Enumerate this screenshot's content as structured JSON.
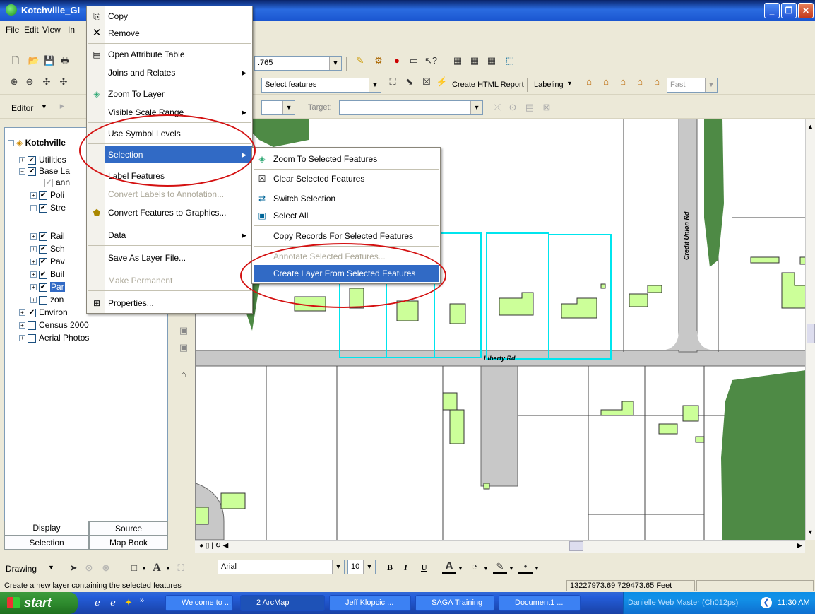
{
  "window": {
    "title": "Kotchville_GI"
  },
  "menubar": {
    "items": [
      "File",
      "Edit",
      "View",
      "In"
    ]
  },
  "toolbar1": {
    "scale_value": ".765"
  },
  "toolbar2": {
    "selection_combo": "Select features",
    "create_report": "Create HTML Report",
    "labeling": "Labeling",
    "fast_combo": "Fast"
  },
  "editor": {
    "label": "Editor",
    "target_label": "Target:"
  },
  "toc": {
    "root": "Kotchville",
    "layers": [
      {
        "label": "Utilities",
        "checked": true
      },
      {
        "label": "Base La",
        "checked": true
      },
      {
        "label": "ann",
        "checked": true
      },
      {
        "label": "Poli",
        "checked": true
      },
      {
        "label": "Stre",
        "checked": true
      },
      {
        "label": "Rail",
        "checked": true
      },
      {
        "label": "Sch",
        "checked": true
      },
      {
        "label": "Pav",
        "checked": true
      },
      {
        "label": "Buil",
        "checked": true
      },
      {
        "label": "Par",
        "checked": true
      },
      {
        "label": "zon",
        "checked": false
      },
      {
        "label": "Environ",
        "checked": true
      },
      {
        "label": "Census 2000",
        "checked": false
      },
      {
        "label": "Aerial Photos",
        "checked": false
      }
    ]
  },
  "toc_tabs": {
    "display": "Display",
    "source": "Source",
    "selection": "Selection",
    "mapbook": "Map Book"
  },
  "context_menu": {
    "items": [
      {
        "label": "Copy",
        "icon": "copy-icon"
      },
      {
        "label": "Remove",
        "icon": "remove-icon"
      },
      {
        "label": "Open Attribute Table",
        "icon": "table-icon"
      },
      {
        "label": "Joins and Relates",
        "submenu": true
      },
      {
        "label": "Zoom To Layer",
        "icon": "zoom-layer-icon"
      },
      {
        "label": "Visible Scale Range",
        "submenu": true
      },
      {
        "label": "Use Symbol Levels"
      },
      {
        "label": "Selection",
        "submenu": true,
        "highlighted": true
      },
      {
        "label": "Label Features"
      },
      {
        "label": "Convert Labels to Annotation...",
        "disabled": true
      },
      {
        "label": "Convert Features to Graphics...",
        "icon": "convert-icon"
      },
      {
        "label": "Data",
        "submenu": true
      },
      {
        "label": "Save As Layer File..."
      },
      {
        "label": "Make Permanent",
        "disabled": true
      },
      {
        "label": "Properties...",
        "icon": "properties-icon"
      }
    ]
  },
  "selection_submenu": {
    "items": [
      {
        "label": "Zoom To Selected Features",
        "icon": "zoom-selected-icon"
      },
      {
        "label": "Clear Selected Features",
        "icon": "clear-selection-icon"
      },
      {
        "label": "Switch Selection",
        "icon": "switch-selection-icon"
      },
      {
        "label": "Select All",
        "icon": "select-all-icon"
      },
      {
        "label": "Copy Records For Selected Features"
      },
      {
        "label": "Annotate Selected Features...",
        "disabled": true
      },
      {
        "label": "Create Layer From Selected Features",
        "highlighted": true
      }
    ]
  },
  "map": {
    "road_labels": {
      "credit_union": "Credit Union Rd",
      "liberty": "Liberty Rd"
    }
  },
  "drawing": {
    "label": "Drawing",
    "font": "Arial",
    "size": "10",
    "bold": "B",
    "italic": "I",
    "underline": "U"
  },
  "status": {
    "message": "Create a new layer containing the selected features",
    "coords": "13227973.69  729473.65 Feet"
  },
  "taskbar": {
    "start": "start",
    "items": [
      "Welcome to ...",
      "2 ArcMap",
      "Jeff Klopcic ...",
      "SAGA Training",
      "Document1 ...",
      "Danielle Web Master (Ch012ps)"
    ],
    "time": "11:30 AM"
  },
  "colors": {
    "highlight": "#316AC5",
    "selection_outline": "#00E5EE",
    "building_fill": "#CCFF99",
    "road_fill": "#C8C8C8",
    "park_fill": "#4E8A45",
    "annotation_oval": "#D41111"
  }
}
